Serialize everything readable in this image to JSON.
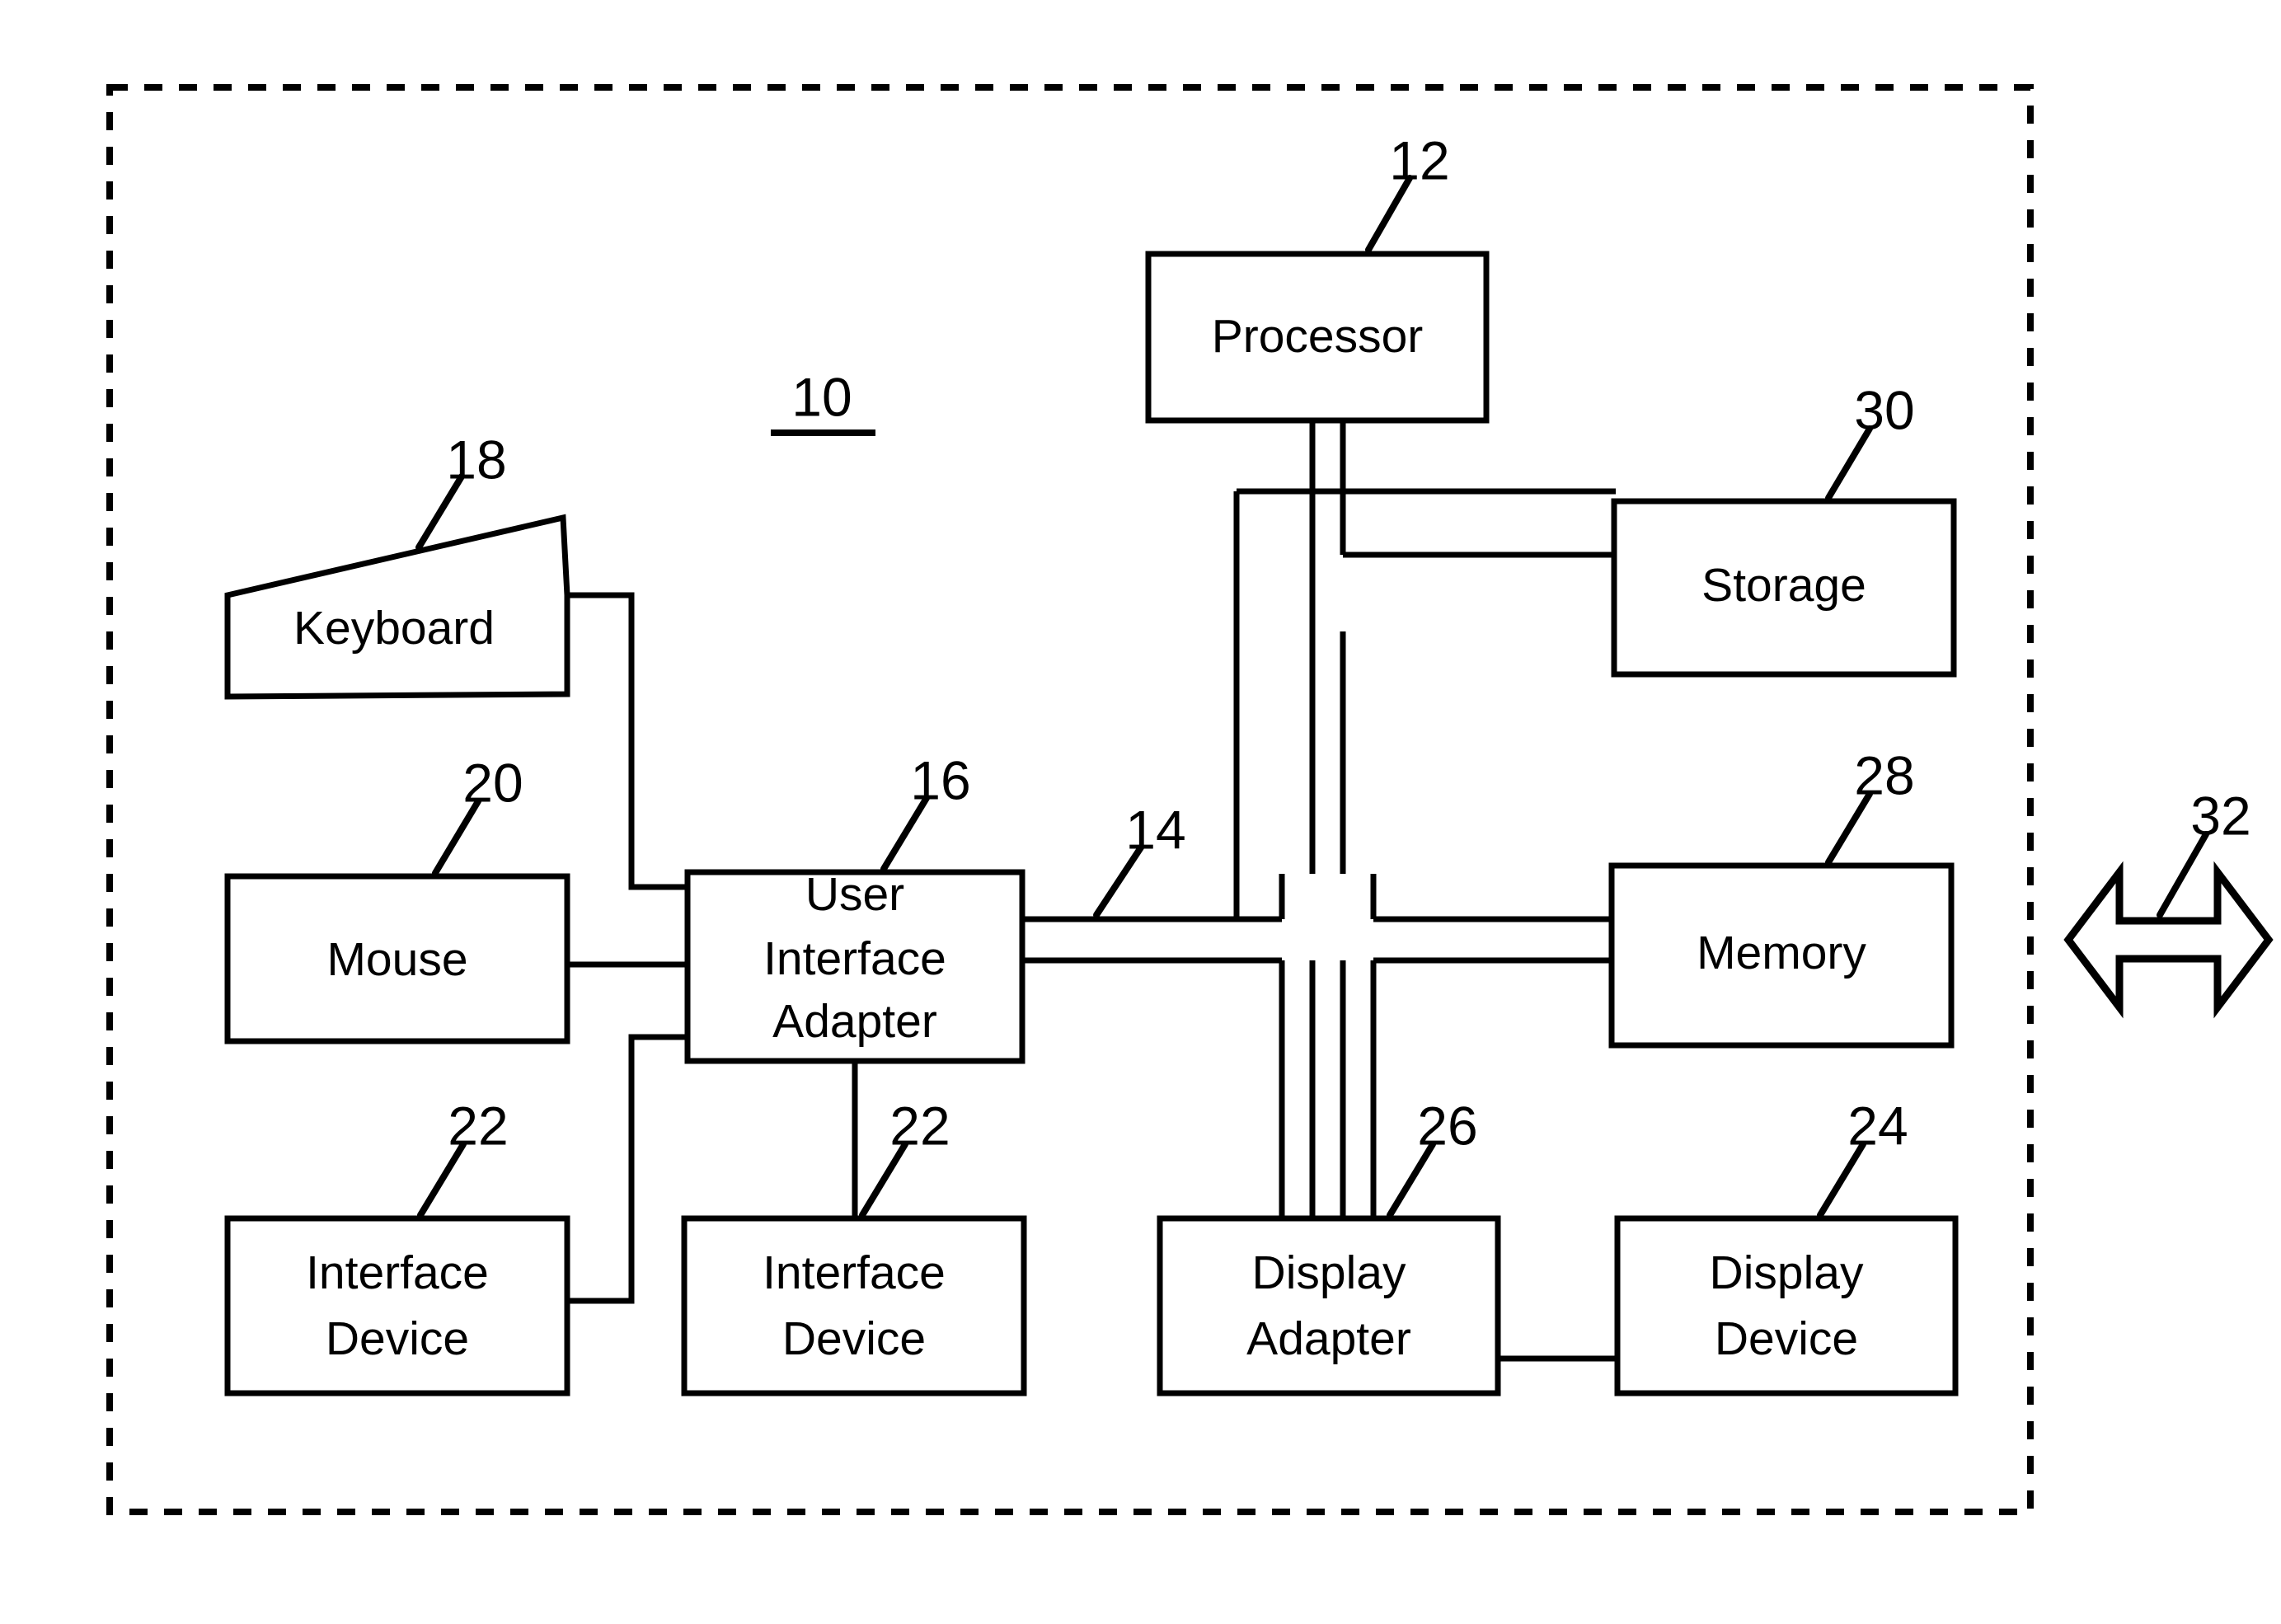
{
  "figure": {
    "system_reference": "10",
    "boundary_style": "dashed",
    "blocks": [
      {
        "id": "processor",
        "label": "Processor",
        "ref": "12"
      },
      {
        "id": "storage",
        "label": "Storage",
        "ref": "30"
      },
      {
        "id": "memory",
        "label": "Memory",
        "ref": "28"
      },
      {
        "id": "keyboard",
        "label": "Keyboard",
        "ref": "18"
      },
      {
        "id": "mouse",
        "label": "Mouse",
        "ref": "20"
      },
      {
        "id": "interface-device-left",
        "label_line1": "Interface",
        "label_line2": "Device",
        "ref": "22"
      },
      {
        "id": "interface-device-center",
        "label_line1": "Interface",
        "label_line2": "Device",
        "ref": "22"
      },
      {
        "id": "user-interface-adapter",
        "label_line1": "User",
        "label_line2": "Interface",
        "label_line3": "Adapter",
        "ref": "16"
      },
      {
        "id": "display-adapter",
        "label_line1": "Display",
        "label_line2": "Adapter",
        "ref": "26"
      },
      {
        "id": "display-device",
        "label_line1": "Display",
        "label_line2": "Device",
        "ref": "24"
      }
    ],
    "bus": {
      "id": "system-bus",
      "ref": "14"
    },
    "network_arrow": {
      "id": "external-link-arrow",
      "ref": "32",
      "direction": "bidirectional"
    },
    "labels": {
      "processor": "Processor",
      "storage": "Storage",
      "memory": "Memory",
      "keyboard": "Keyboard",
      "mouse": "Mouse",
      "interface": "Interface",
      "device": "Device",
      "user": "User",
      "adapter": "Adapter",
      "display": "Display"
    },
    "refs": {
      "system": "10",
      "processor": "12",
      "bus": "14",
      "ui_adapter": "16",
      "keyboard": "18",
      "mouse": "20",
      "interface_device_left": "22",
      "interface_device_center": "22",
      "display_device": "24",
      "display_adapter": "26",
      "memory": "28",
      "storage": "30",
      "arrow": "32"
    },
    "colors": {
      "ink": "#000000",
      "paper": "#ffffff"
    }
  }
}
